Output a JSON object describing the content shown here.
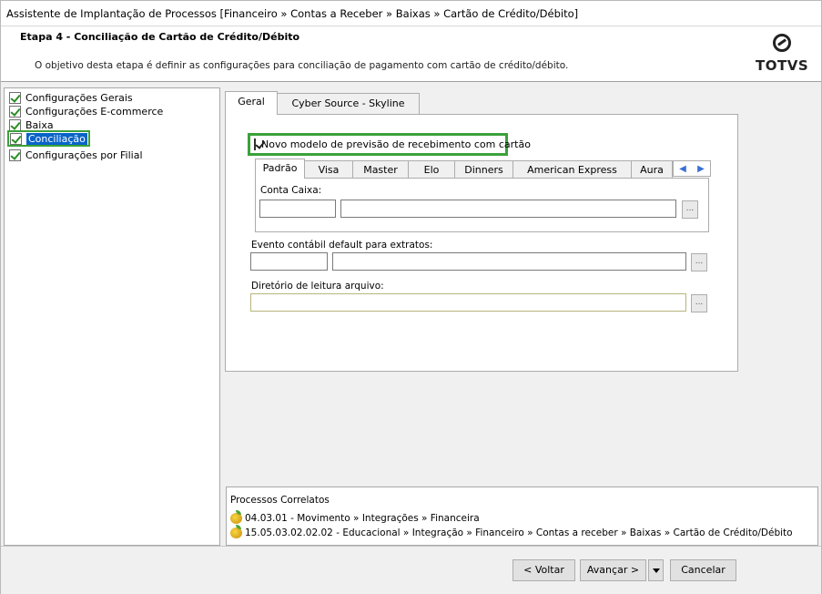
{
  "window": {
    "title": "Assistente de Implantação de Processos [Financeiro » Contas a Receber » Baixas » Cartão de Crédito/Débito]"
  },
  "header": {
    "step_title": "Etapa 4 - Conciliação de Cartão de Crédito/Débito",
    "step_description": "O objetivo desta etapa é definir as configurações para conciliação de pagamento com cartão de crédito/débito.",
    "logo_text": "TOTVS"
  },
  "sidebar": {
    "items": [
      {
        "label": "Configurações Gerais"
      },
      {
        "label": "Configurações E-commerce"
      },
      {
        "label": "Baixa"
      },
      {
        "label": "Conciliação"
      },
      {
        "label": "Configurações por Filial"
      }
    ],
    "selected": "Conciliação"
  },
  "tabs": [
    {
      "label": "Geral"
    },
    {
      "label": "Cyber Source - Skyline"
    }
  ],
  "geral": {
    "checkbox_label": "Novo modelo de previsão de recebimento com cartão",
    "checkbox_checked": true,
    "subtabs": [
      {
        "label": "Padrão"
      },
      {
        "label": "Visa"
      },
      {
        "label": "Master"
      },
      {
        "label": "Elo"
      },
      {
        "label": "Dinners"
      },
      {
        "label": "American Express"
      },
      {
        "label": "Aura"
      }
    ],
    "conta_caixa_label": "Conta Caixa:",
    "conta_caixa_code": "",
    "conta_caixa_desc": "",
    "evento_label": "Evento contábil default para extratos:",
    "evento_code": "",
    "evento_desc": "",
    "diretorio_label": "Diretório de leitura arquivo:",
    "diretorio_value": "",
    "lookup_button": "..."
  },
  "correlatos": {
    "title": "Processos Correlatos",
    "items": [
      {
        "text": "04.03.01 - Movimento » Integrações » Financeira"
      },
      {
        "text": "15.05.03.02.02.02 - Educacional » Integração » Financeiro » Contas a receber » Baixas » Cartão de Crédito/Débito"
      }
    ]
  },
  "footer": {
    "back": "< Voltar",
    "next": "Avançar >",
    "cancel": "Cancelar"
  },
  "colors": {
    "highlight": "#3aa13a",
    "selection": "#0a64c8"
  }
}
